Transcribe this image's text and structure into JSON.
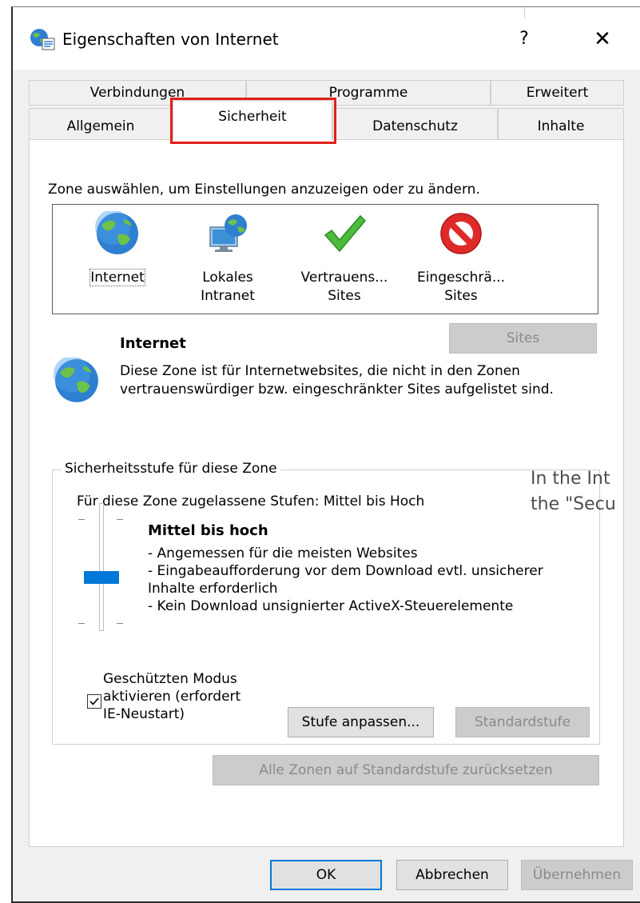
{
  "window": {
    "title": "Eigenschaften von Internet",
    "help_label": "?",
    "close_label": "✕"
  },
  "tabs": {
    "row1": [
      "Verbindungen",
      "Programme",
      "Erweitert"
    ],
    "row2": [
      "Allgemein",
      "Sicherheit",
      "Datenschutz",
      "Inhalte"
    ],
    "active": "Sicherheit"
  },
  "zones": {
    "prompt": "Zone auswählen, um Einstellungen anzuzeigen oder zu ändern.",
    "items": [
      {
        "label_line1": "Internet",
        "label_line2": "",
        "icon": "globe-icon"
      },
      {
        "label_line1": "Lokales",
        "label_line2": "Intranet",
        "icon": "intranet-icon"
      },
      {
        "label_line1": "Vertrauens...",
        "label_line2": "Sites",
        "icon": "checkmark-icon"
      },
      {
        "label_line1": "Eingeschrä...",
        "label_line2": "Sites",
        "icon": "restricted-icon"
      }
    ],
    "selected": "Internet"
  },
  "sites_button": "Sites",
  "zone_info": {
    "title": "Internet",
    "description": "Diese Zone ist für Internetwebsites, die nicht in den Zonen vertrauenswürdiger bzw. eingeschränkter Sites aufgelistet sind."
  },
  "overlay": {
    "line1": "In the Int",
    "line2": "the \"Secu"
  },
  "security_level": {
    "group_label": "Sicherheitsstufe für diese Zone",
    "allowed": "Für diese Zone zugelassene Stufen: Mittel bis Hoch",
    "level_title": "Mittel bis hoch",
    "desc1": "- Angemessen für die meisten Websites",
    "desc2": "- Eingabeaufforderung vor dem Download evtl. unsicherer",
    "desc3": "Inhalte erforderlich",
    "desc4": "- Kein Download unsignierter ActiveX-Steuerelemente",
    "slider_position": "Mittel bis hoch"
  },
  "protected_mode": {
    "line1": "Geschützten Modus",
    "line2": "aktivieren (erfordert",
    "line3": "IE-Neustart)",
    "checked": true
  },
  "buttons": {
    "custom_level": "Stufe anpassen...",
    "default_level": "Standardstufe",
    "reset_all": "Alle Zonen auf Standardstufe zurücksetzen",
    "ok": "OK",
    "cancel": "Abbrechen",
    "apply": "Übernehmen"
  },
  "colors": {
    "accent": "#0078d7",
    "highlight": "#e0201a"
  }
}
